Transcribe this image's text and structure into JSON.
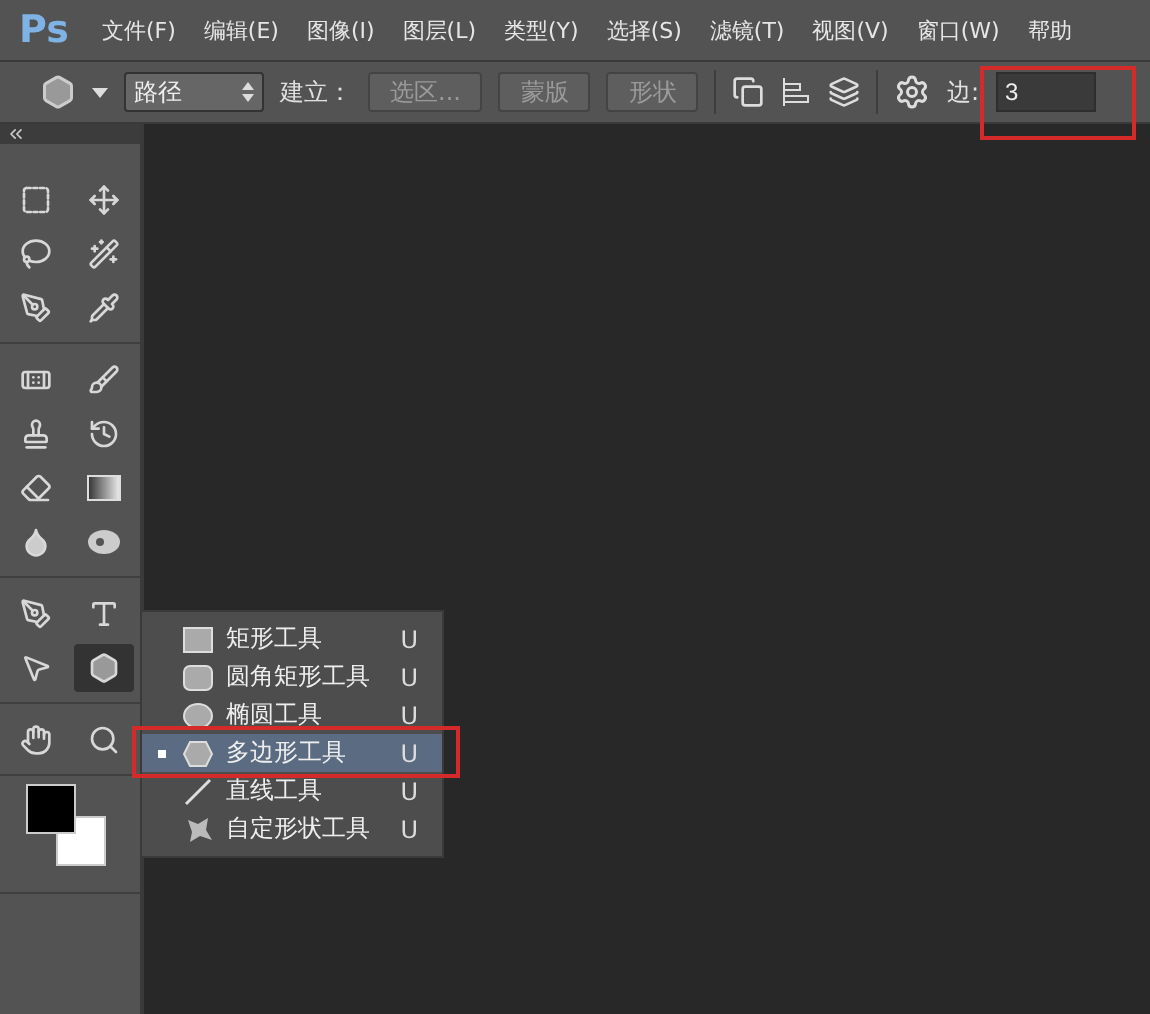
{
  "app": {
    "logo": "Ps"
  },
  "menu": [
    "文件(F)",
    "编辑(E)",
    "图像(I)",
    "图层(L)",
    "类型(Y)",
    "选择(S)",
    "滤镜(T)",
    "视图(V)",
    "窗口(W)",
    "帮助"
  ],
  "options_bar": {
    "mode": "路径",
    "build_label": "建立：",
    "buttons": [
      "选区...",
      "蒙版",
      "形状"
    ],
    "sides_label": "边:",
    "sides_value": "3",
    "sides_highlighted": true
  },
  "tool_groups": [
    [
      {
        "kind": "marquee",
        "selected": false
      },
      {
        "kind": "move",
        "selected": false
      },
      {
        "kind": "lasso",
        "selected": false
      },
      {
        "kind": "wand",
        "selected": false
      },
      {
        "kind": "crop",
        "selected": false
      },
      {
        "kind": "eyedropper",
        "selected": false
      }
    ],
    [
      {
        "kind": "heal",
        "selected": false
      },
      {
        "kind": "brush",
        "selected": false
      },
      {
        "kind": "stamp",
        "selected": false
      },
      {
        "kind": "history",
        "selected": false
      },
      {
        "kind": "eraser",
        "selected": false
      },
      {
        "kind": "gradient",
        "selected": false
      },
      {
        "kind": "blur",
        "selected": false
      },
      {
        "kind": "dodge",
        "selected": false
      }
    ],
    [
      {
        "kind": "pen",
        "selected": false
      },
      {
        "kind": "type",
        "selected": false
      },
      {
        "kind": "pointer",
        "selected": false
      },
      {
        "kind": "shape",
        "selected": true
      }
    ],
    [
      {
        "kind": "hand",
        "selected": false
      },
      {
        "kind": "zoom",
        "selected": false
      }
    ]
  ],
  "flyout": [
    {
      "kind": "rect",
      "label": "矩形工具",
      "shortcut": "U",
      "selected": false,
      "highlighted": false
    },
    {
      "kind": "rounded",
      "label": "圆角矩形工具",
      "shortcut": "U",
      "selected": false,
      "highlighted": false
    },
    {
      "kind": "ellipse",
      "label": "椭圆工具",
      "shortcut": "U",
      "selected": false,
      "highlighted": false
    },
    {
      "kind": "polygon",
      "label": "多边形工具",
      "shortcut": "U",
      "selected": true,
      "highlighted": true
    },
    {
      "kind": "line",
      "label": "直线工具",
      "shortcut": "U",
      "selected": false,
      "highlighted": false
    },
    {
      "kind": "custom",
      "label": "自定形状工具",
      "shortcut": "U",
      "selected": false,
      "highlighted": false
    }
  ]
}
